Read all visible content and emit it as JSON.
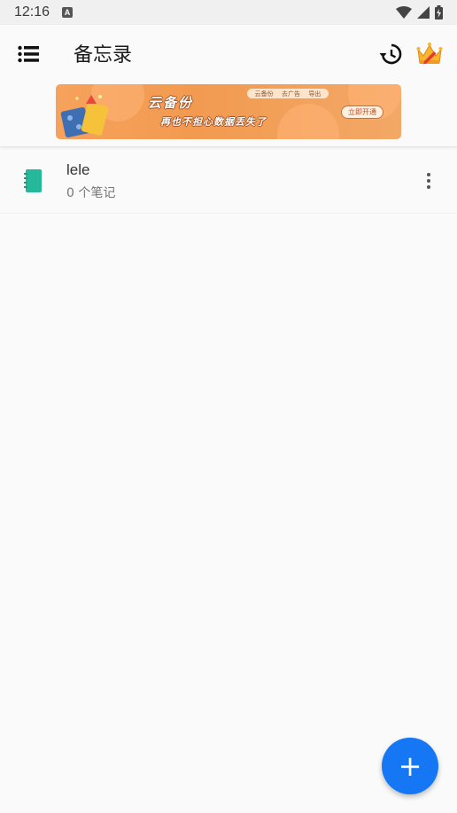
{
  "status_bar": {
    "time": "12:16",
    "notification_badge": "A",
    "icons": [
      "wifi-icon",
      "signal-icon",
      "battery-charging-icon"
    ]
  },
  "app_bar": {
    "title": "备忘录",
    "icons": [
      "menu-list-icon",
      "history-icon",
      "vip-crown-icon"
    ]
  },
  "banner": {
    "title": "云备份",
    "subtitle": "再也不担心数据丢失了",
    "tags": [
      "云备份",
      "去广告",
      "导出"
    ],
    "cta": "立即开通",
    "colors": {
      "background": "#f29a50",
      "text_outline": "#a34d1c"
    }
  },
  "notebooks": [
    {
      "name": "lele",
      "count_text": "0 个笔记",
      "icon": "notebook-icon",
      "icon_color": "#26b89a"
    }
  ],
  "fab": {
    "label": "+",
    "icon": "add-icon",
    "color": "#1677f5"
  }
}
